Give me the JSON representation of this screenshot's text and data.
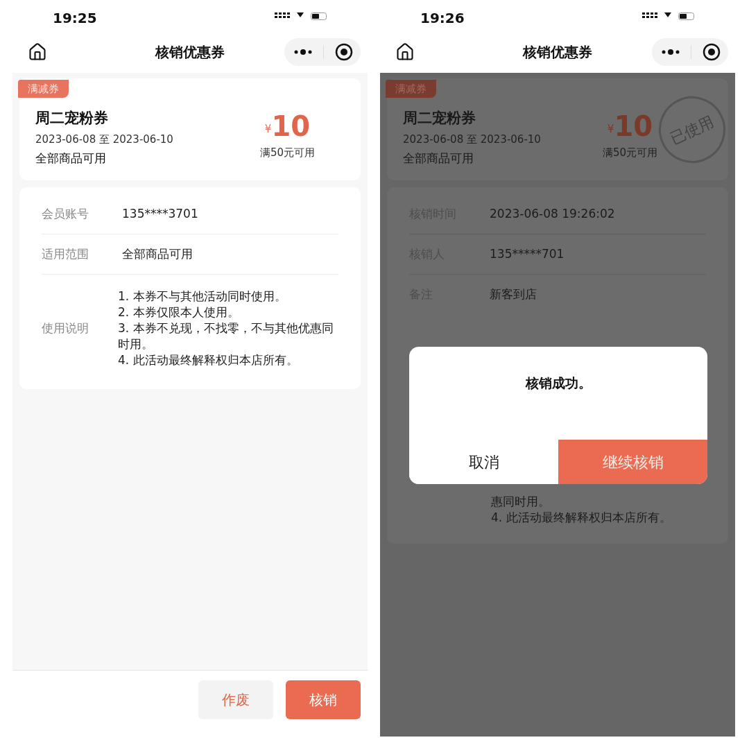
{
  "screens": [
    {
      "dimmed": false,
      "status_bar": {
        "time": "19:25"
      },
      "nav": {
        "title": "核销优惠券"
      },
      "coupon": {
        "tag": "满减券",
        "name": "周二宠粉券",
        "dates": "2023-06-08 至 2023-06-10",
        "scope": "全部商品可用",
        "currency": "¥",
        "amount": "10",
        "condition": "满50元可用",
        "used": false
      },
      "details": [
        {
          "label": "会员账号",
          "value": "135****3701"
        },
        {
          "label": "适用范围",
          "value": "全部商品可用"
        }
      ],
      "notes": {
        "label": "使用说明",
        "lines": [
          "1. 本券不与其他活动同时使用。",
          "2. 本券仅限本人使用。",
          "3. 本券不兑现，不找零，不与其他优惠同时用。",
          "4. 此活动最终解释权归本店所有。"
        ]
      },
      "footer_buttons": [
        {
          "label": "作废",
          "kind": "secondary"
        },
        {
          "label": "核销",
          "kind": "primary"
        }
      ]
    },
    {
      "dimmed": true,
      "status_bar": {
        "time": "19:26"
      },
      "nav": {
        "title": "核销优惠券"
      },
      "coupon": {
        "tag": "满减券",
        "name": "周二宠粉券",
        "dates": "2023-06-08 至 2023-06-10",
        "scope": "全部商品可用",
        "currency": "¥",
        "amount": "10",
        "condition": "满50元可用",
        "used": true,
        "stamp": "已使用"
      },
      "details": [
        {
          "label": "核销时间",
          "value": "2023-06-08 19:26:02"
        },
        {
          "label": "核销人",
          "value": "135*****701"
        },
        {
          "label": "备注",
          "value": "新客到店"
        }
      ],
      "notes": {
        "lines": [
          "惠同时用。",
          "4. 此活动最终解释权归本店所有。"
        ]
      },
      "dialog": {
        "message": "核销成功。",
        "buttons": [
          {
            "label": "取消",
            "kind": "secondary"
          },
          {
            "label": "继续核销",
            "kind": "primary"
          }
        ]
      }
    }
  ]
}
